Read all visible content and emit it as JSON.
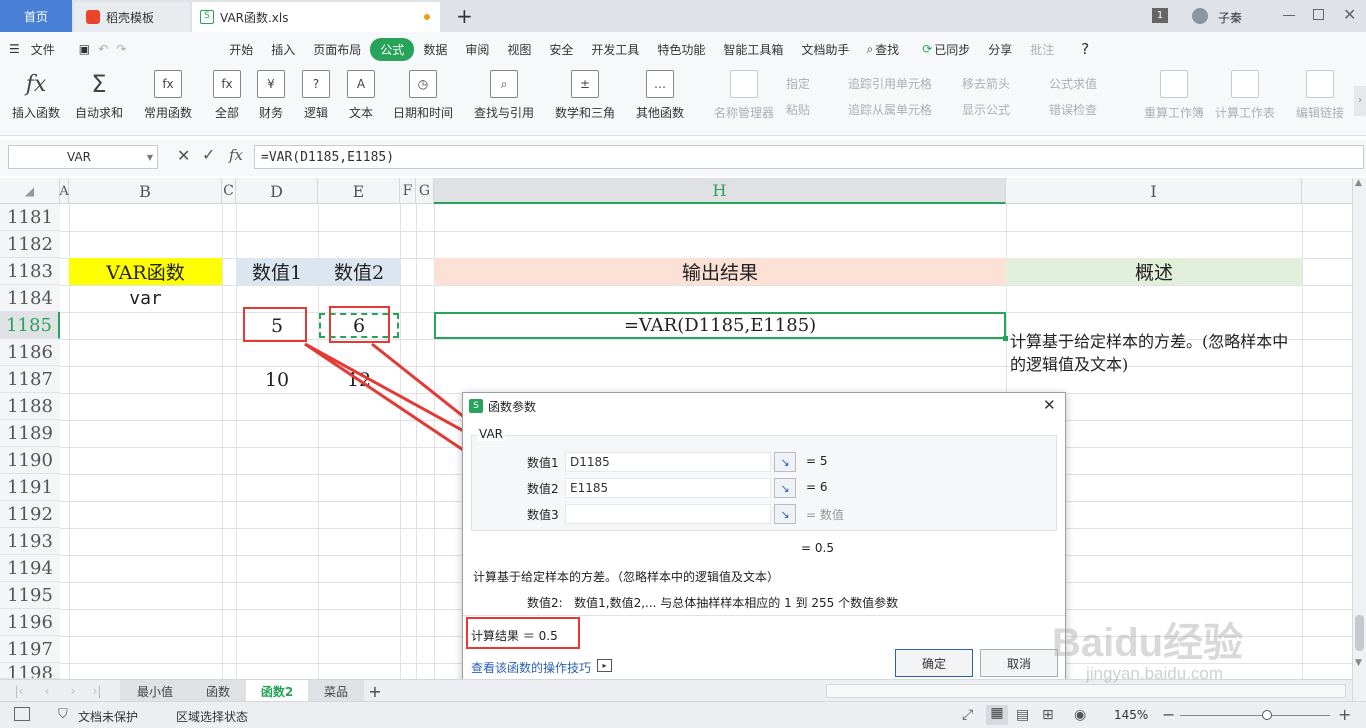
{
  "titlebar": {
    "tabs": [
      {
        "label": "首页"
      },
      {
        "label": "稻壳模板"
      },
      {
        "label": "VAR函数.xls"
      }
    ],
    "add_tab": "+",
    "badge": "1",
    "user": "子秦"
  },
  "menubar": {
    "file": "文件",
    "items": [
      "开始",
      "插入",
      "页面布局",
      "公式",
      "数据",
      "审阅",
      "视图",
      "安全",
      "开发工具",
      "特色功能",
      "智能工具箱",
      "文档助手"
    ],
    "active": "公式",
    "search": "查找",
    "synced": "已同步",
    "share": "分享",
    "comment": "批注",
    "help": "?"
  },
  "ribbon": {
    "buttons": [
      {
        "label": "插入函数",
        "icon": "fx"
      },
      {
        "label": "自动求和",
        "icon": "Σ"
      },
      {
        "label": "常用函数",
        "icon": "fx"
      },
      {
        "label": "全部",
        "icon": "fx"
      },
      {
        "label": "财务",
        "icon": "¥"
      },
      {
        "label": "逻辑",
        "icon": "?"
      },
      {
        "label": "文本",
        "icon": "A"
      },
      {
        "label": "日期和时间",
        "icon": "◷"
      },
      {
        "label": "查找与引用",
        "icon": "⌕"
      },
      {
        "label": "数学和三角",
        "icon": "±"
      },
      {
        "label": "其他函数",
        "icon": "…"
      }
    ],
    "disabled": {
      "name_manager": "名称管理器",
      "assign": "指定",
      "paste": "粘贴",
      "trace_precedents": "追踪引用单元格",
      "trace_dependents": "追踪从属单元格",
      "remove_arrows": "移去箭头",
      "show_formulas": "显示公式",
      "evaluate": "公式求值",
      "error_check": "错误检查",
      "recalc_book": "重算工作簿",
      "calc_sheet": "计算工作表",
      "edit_links": "编辑链接"
    }
  },
  "formula_bar": {
    "name_box": "VAR",
    "formula": "=VAR(D1185,E1185)"
  },
  "grid": {
    "columns": [
      "A",
      "B",
      "C",
      "D",
      "E",
      "F",
      "G",
      "H",
      "I"
    ],
    "rows": [
      "1181",
      "1182",
      "1183",
      "1184",
      "1185",
      "1186",
      "1187",
      "1188",
      "1189",
      "1190",
      "1191",
      "1192",
      "1193",
      "1194",
      "1195",
      "1196",
      "1197",
      "1198"
    ],
    "b1183": "VAR函数",
    "b1184": "var",
    "d1183": "数值1",
    "e1183": "数值2",
    "h1183": "输出结果",
    "i1183": "概述",
    "d1185": "5",
    "e1185": "6",
    "h1185": "=VAR(D1185,E1185)",
    "i1185": "计算基于给定样本的方差。(忽略样本中的逻辑值及文本)",
    "d1187": "10",
    "e1187": "12"
  },
  "dialog": {
    "title": "函数参数",
    "func": "VAR",
    "args": [
      {
        "label": "数值1",
        "value": "D1185",
        "result": "= 5"
      },
      {
        "label": "数值2",
        "value": "E1185",
        "result": "= 6"
      },
      {
        "label": "数值3",
        "value": "",
        "result": "= 数值"
      }
    ],
    "total": "= 0.5",
    "description": "计算基于给定样本的方差。（忽略样本中的逻辑值及文本）",
    "arg_help": "数值2:   数值1,数值2,... 与总体抽样样本相应的 1 到 255 个数值参数",
    "calc_result": "计算结果 ＝ 0.5",
    "tips_link": "查看该函数的操作技巧",
    "ok": "确定",
    "cancel": "取消"
  },
  "sheets": {
    "tabs": [
      "最小值",
      "函数",
      "函数2",
      "菜品"
    ],
    "active": "函数2",
    "add": "+"
  },
  "statusbar": {
    "protect": "文档未保护",
    "selection": "区域选择状态",
    "zoom": "145%"
  },
  "watermark": {
    "logo": "Baidu经验",
    "url": "jingyan.baidu.com"
  },
  "colors": {
    "accent_green": "#27a35a",
    "home_tab": "#4a7fd6",
    "highlight_yellow": "#ffff00",
    "header_blue": "#dce6f1",
    "header_peach": "#fbe1d6",
    "header_green": "#e2efda",
    "annotation_red": "#e53935"
  }
}
